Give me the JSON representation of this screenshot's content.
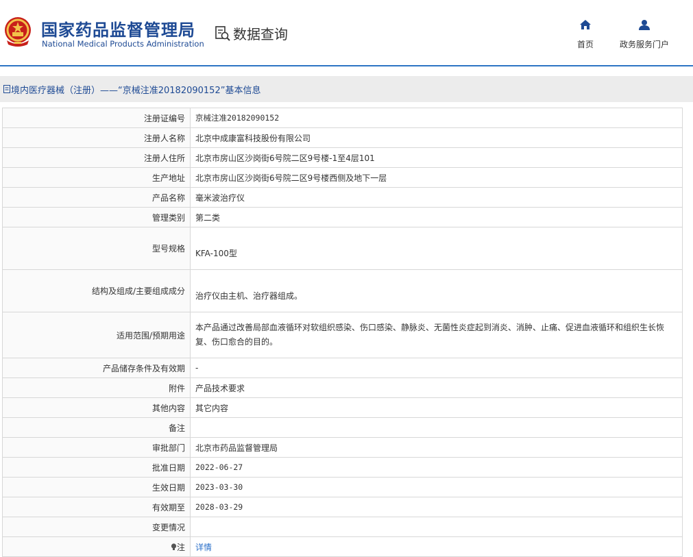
{
  "header": {
    "org_cn": "国家药品监督管理局",
    "org_en": "National Medical Products Administration",
    "query_label": "数据查询",
    "nav": [
      {
        "label": "首页",
        "icon": "home-icon"
      },
      {
        "label": "政务服务门户",
        "icon": "user-icon"
      }
    ],
    "accent_color": "#1e4a94",
    "line_color": "#2c74c4"
  },
  "breadcrumb": {
    "text": "境内医疗器械（注册）——“京械注准20182090152”基本信息"
  },
  "table": {
    "rows": [
      {
        "label": "注册证编号",
        "value": "京械注准20182090152"
      },
      {
        "label": "注册人名称",
        "value": "北京中成康富科技股份有限公司"
      },
      {
        "label": "注册人住所",
        "value": "北京市房山区沙岗街6号院二区9号楼-1至4层101"
      },
      {
        "label": "生产地址",
        "value": "北京市房山区沙岗街6号院二区9号楼西侧及地下一层"
      },
      {
        "label": "产品名称",
        "value": "毫米波治疗仪"
      },
      {
        "label": "管理类别",
        "value": "第二类"
      },
      {
        "label": "型号规格",
        "value": "KFA-100型"
      },
      {
        "label": "结构及组成/主要组成成分",
        "value": "治疗仪由主机、治疗器组成。"
      },
      {
        "label": "适用范围/预期用途",
        "value": "本产品通过改善局部血液循环对软组织感染、伤口感染、静脉炎、无菌性炎症起到消炎、消肿、止痛、促进血液循环和组织生长恢复、伤口愈合的目的。"
      },
      {
        "label": "产品储存条件及有效期",
        "value": "-"
      },
      {
        "label": "附件",
        "value": "产品技术要求"
      },
      {
        "label": "其他内容",
        "value": "其它内容"
      },
      {
        "label": "备注",
        "value": ""
      },
      {
        "label": "审批部门",
        "value": "北京市药品监督管理局"
      },
      {
        "label": "批准日期",
        "value": "2022-06-27"
      },
      {
        "label": "生效日期",
        "value": "2023-03-30"
      },
      {
        "label": "有效期至",
        "value": "2028-03-29"
      },
      {
        "label": "变更情况",
        "value": ""
      },
      {
        "label": "注",
        "value": "详情"
      }
    ]
  }
}
